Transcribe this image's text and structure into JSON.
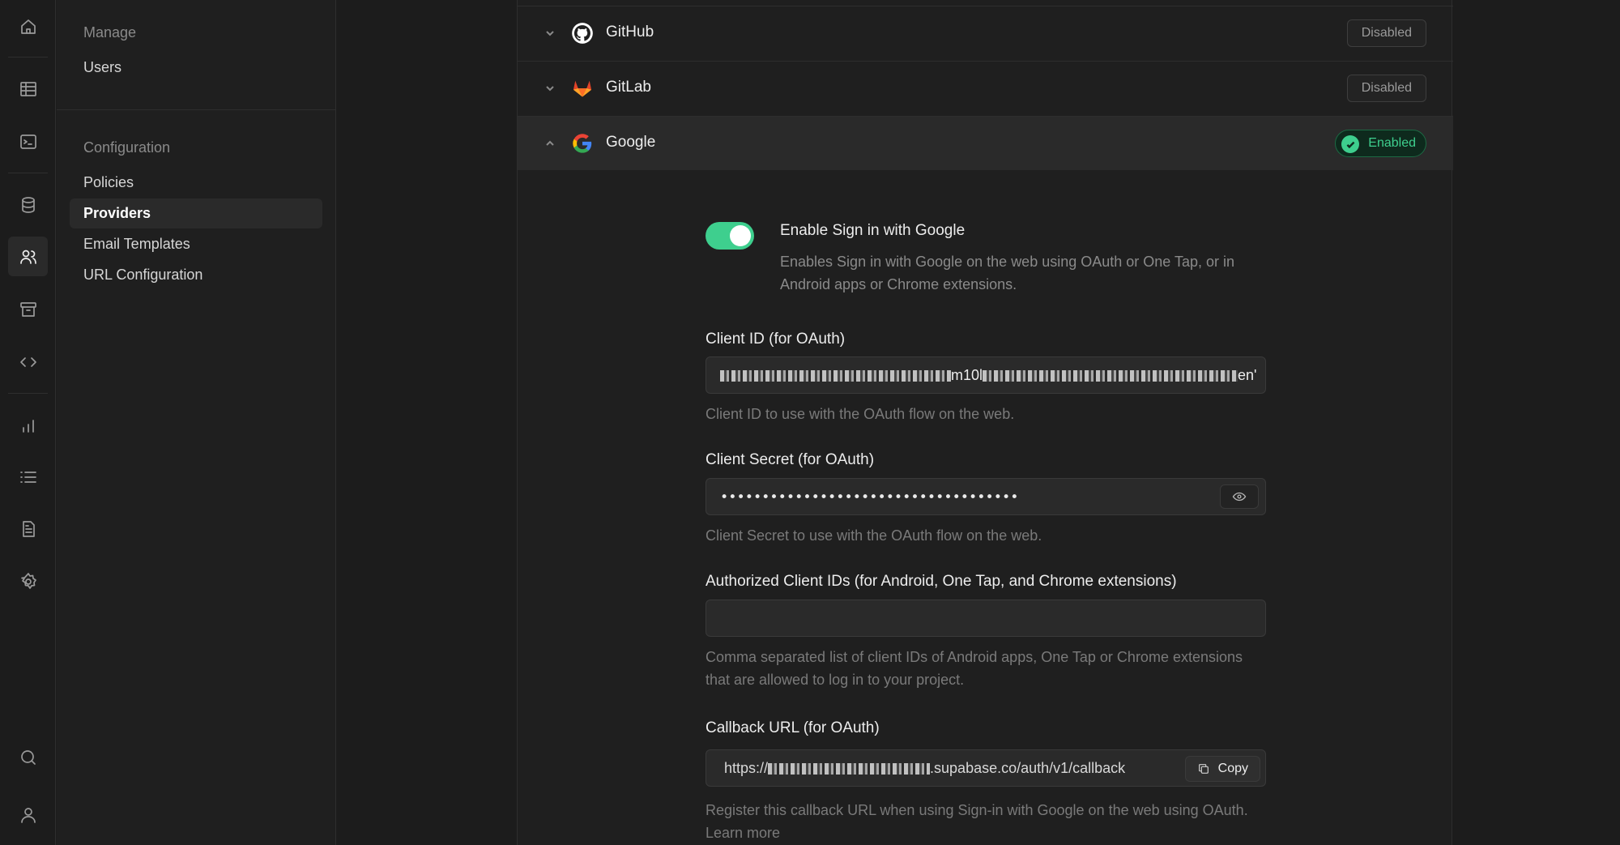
{
  "rail": {
    "icons": [
      "home-icon",
      "table-editor-icon",
      "sql-editor-icon",
      "database-icon",
      "auth-users-icon",
      "storage-icon",
      "edge-functions-icon",
      "reports-icon",
      "logs-icon",
      "docs-icon",
      "settings-icon",
      "search-icon",
      "account-icon"
    ]
  },
  "sidebar": {
    "manage_title": "Manage",
    "manage_items": [
      "Users"
    ],
    "config_title": "Configuration",
    "config_items": [
      "Policies",
      "Providers",
      "Email Templates",
      "URL Configuration"
    ],
    "active": "Providers"
  },
  "providers": [
    {
      "name": "GitHub",
      "status": "Disabled",
      "expanded": false
    },
    {
      "name": "GitLab",
      "status": "Disabled",
      "expanded": false
    },
    {
      "name": "Google",
      "status": "Enabled",
      "expanded": true
    }
  ],
  "google": {
    "toggle_title": "Enable Sign in with Google",
    "toggle_desc": "Enables Sign in with Google on the web using OAuth or One Tap, or in Android apps or Chrome extensions.",
    "client_id_label": "Client ID (for OAuth)",
    "client_id_value_visible": "m10l",
    "client_id_value_tail": "en'",
    "client_id_help": "Client ID to use with the OAuth flow on the web.",
    "client_secret_label": "Client Secret (for OAuth)",
    "client_secret_value": "••••••••••••••••••••••••••••••••••••",
    "client_secret_help": "Client Secret to use with the OAuth flow on the web.",
    "authorized_label": "Authorized Client IDs (for Android, One Tap, and Chrome extensions)",
    "authorized_value": "",
    "authorized_help": "Comma separated list of client IDs of Android apps, One Tap or Chrome extensions that are allowed to log in to your project.",
    "callback_label": "Callback URL (for OAuth)",
    "callback_prefix": "https://",
    "callback_suffix": ".supabase.co/auth/v1/callback",
    "copy_label": "Copy",
    "callback_help": "Register this callback URL when using Sign-in with Google on the web using OAuth. Learn more"
  },
  "colors": {
    "accent": "#3ecf8e",
    "enabled_bg": "#0e2a1d",
    "gitlab": "#e24329"
  }
}
